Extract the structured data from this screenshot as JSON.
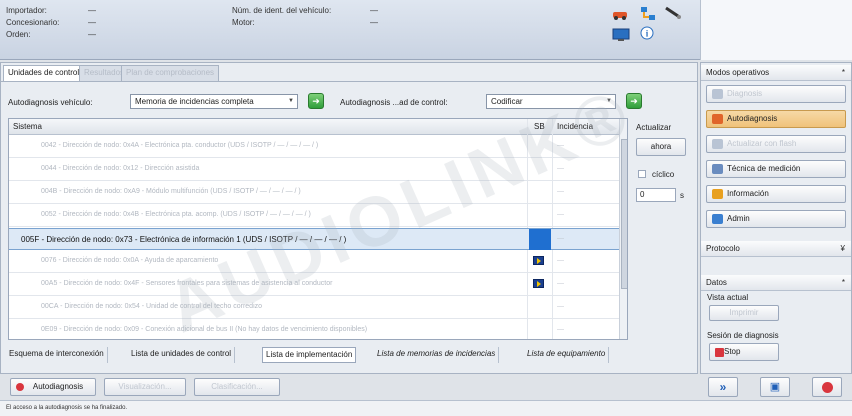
{
  "header": {
    "importador_label": "Importador:",
    "importador_value": "—",
    "concesionario_label": "Concesionario:",
    "concesionario_value": "—",
    "orden_label": "Orden:",
    "orden_value": "—",
    "vin_label": "Núm. de ident. del vehículo:",
    "vin_value": "—",
    "motor_label": "Motor:",
    "motor_value": "—"
  },
  "tabs": [
    "Unidades de control",
    "Resultados",
    "Plan de comprobaciones"
  ],
  "toolbar": {
    "autodiag_vehiculo_label": "Autodiagnosis vehículo:",
    "autodiag_vehiculo_value": "Memoria de incidencias completa",
    "autodiag_unidad_label": "Autodiagnosis ...ad de control:",
    "autodiag_unidad_value": "Codificar"
  },
  "table": {
    "columns": [
      "Sistema",
      "SB",
      "Incidencia"
    ],
    "rows": [
      {
        "text": "0042 - Dirección de nodo: 0x4A - Electrónica pta. conductor  (UDS / ISOTP / — / — / — / )",
        "sb": false,
        "inc": "—"
      },
      {
        "text": "0044 - Dirección de nodo: 0x12 - Dirección asistida",
        "sb": false,
        "inc": "—"
      },
      {
        "text": "004B - Dirección de nodo: 0xA9 - Módulo multifunción  (UDS / ISOTP / — / — / — / )",
        "sb": false,
        "inc": "—"
      },
      {
        "text": "0052 - Dirección de nodo: 0x4B - Electrónica pta. acomp.  (UDS / ISOTP / — / — / — / )",
        "sb": false,
        "inc": "—"
      },
      {
        "text": "005F - Dirección de nodo: 0x73 - Electrónica de información 1  (UDS / ISOTP / — / — / — / )",
        "sb": false,
        "inc": "—"
      },
      {
        "text": "0076 - Dirección de nodo: 0x0A - Ayuda de aparcamiento",
        "sb": true,
        "inc": "—"
      },
      {
        "text": "00A5 - Dirección de nodo: 0x4F - Sensores frontales para sistemas de asistencia al conductor",
        "sb": true,
        "inc": "—"
      },
      {
        "text": "00CA - Dirección de nodo: 0x54 - Unidad de control del techo corredizo",
        "sb": false,
        "inc": "—"
      },
      {
        "text": "0E09 - Dirección de nodo: 0x09 - Conexión adicional de bus II  (No hay datos de vencimiento disponibles)",
        "sb": false,
        "inc": "—"
      }
    ],
    "selected_index": 4
  },
  "side": {
    "actualizar_label": "Actualizar",
    "ahora_label": "ahora",
    "ciclico_label": "cíclico",
    "interval_value": "0",
    "interval_unit": "s"
  },
  "watermark": "AUDIOLINK®",
  "bottom_tabs": [
    "Esquema de interconexión",
    "Lista de unidades de control",
    "Lista de implementación",
    "Lista de memorias de incidencias",
    "Lista de equipamiento"
  ],
  "footer": {
    "autodiag_btn": "Autodiagnosis",
    "visualizacion_btn": "Visualización...",
    "clasificacion_btn": "Clasificación..."
  },
  "right_panel": {
    "modos_title": "Modos operativos",
    "modes": [
      {
        "label": "Diagnosis",
        "state": "disabled"
      },
      {
        "label": "Autodiagnosis",
        "state": "active"
      },
      {
        "label": "Actualizar con flash",
        "state": "disabled"
      },
      {
        "label": "Técnica de medición",
        "state": "normal"
      },
      {
        "label": "Información",
        "state": "normal"
      },
      {
        "label": "Admin",
        "state": "normal"
      }
    ],
    "protocolo_title": "Protocolo",
    "datos_title": "Datos",
    "vista_actual_label": "Vista actual",
    "imprimir_btn": "Imprimir",
    "sesion_label": "Sesión de diagnosis",
    "stop_btn": "Stop"
  },
  "status_text": "El acceso a la autodiagnosis se ha finalizado.",
  "colors": {
    "accent": "#f0c27a",
    "selection": "#dde9f6",
    "sb_blue": "#1b3f8f",
    "go_green": "#2f9e3a",
    "stop_red": "#d9363e"
  }
}
